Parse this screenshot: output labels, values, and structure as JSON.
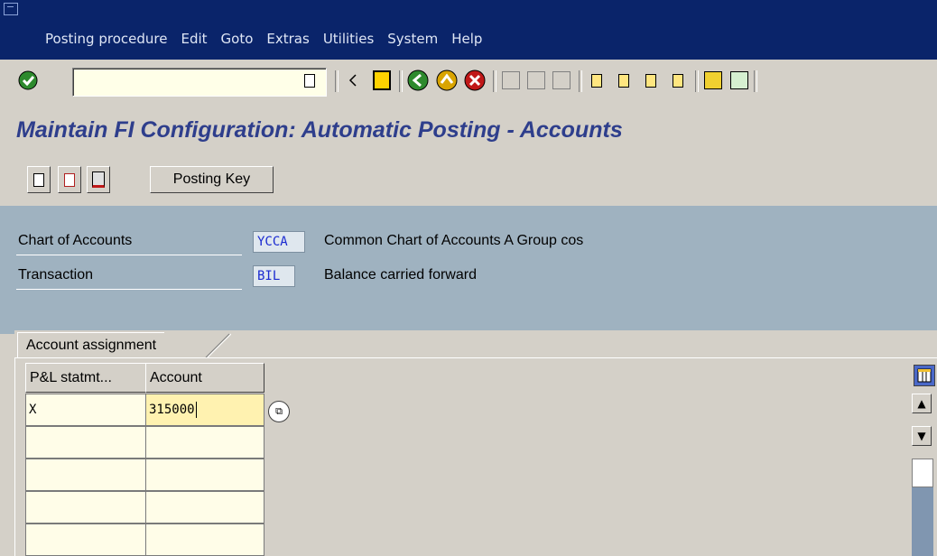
{
  "menu": [
    "Posting procedure",
    "Edit",
    "Goto",
    "Extras",
    "Utilities",
    "System",
    "Help"
  ],
  "toolbar": {
    "command_field": "",
    "icons": [
      "enter-icon",
      "save-icon",
      "back-icon",
      "exit-icon",
      "cancel-icon",
      "print-icon",
      "find-icon",
      "find-next-icon",
      "first-page-icon",
      "previous-page-icon",
      "next-page-icon",
      "last-page-icon",
      "new-session-icon",
      "shortcut-icon"
    ]
  },
  "title": "Maintain FI Configuration: Automatic Posting - Accounts",
  "app_toolbar": {
    "posting_key_label": "Posting Key"
  },
  "header": {
    "chart_label": "Chart of Accounts",
    "chart_code": "YCCA",
    "chart_desc": "Common Chart of Accounts A Group cos",
    "trans_label": "Transaction",
    "trans_code": "BIL",
    "trans_desc": "Balance carried forward"
  },
  "tab": {
    "label": "Account assignment"
  },
  "table": {
    "columns": [
      "P&L statmt...",
      "Account"
    ],
    "rows": [
      [
        "X",
        "315000"
      ],
      [
        "",
        ""
      ],
      [
        "",
        ""
      ],
      [
        "",
        ""
      ],
      [
        "",
        ""
      ]
    ]
  },
  "colors": {
    "menubar": "#0a246a",
    "title": "#2e3e8c",
    "panel": "#9fb2c0",
    "input": "#fffde8",
    "active_input": "#fff2b0"
  }
}
